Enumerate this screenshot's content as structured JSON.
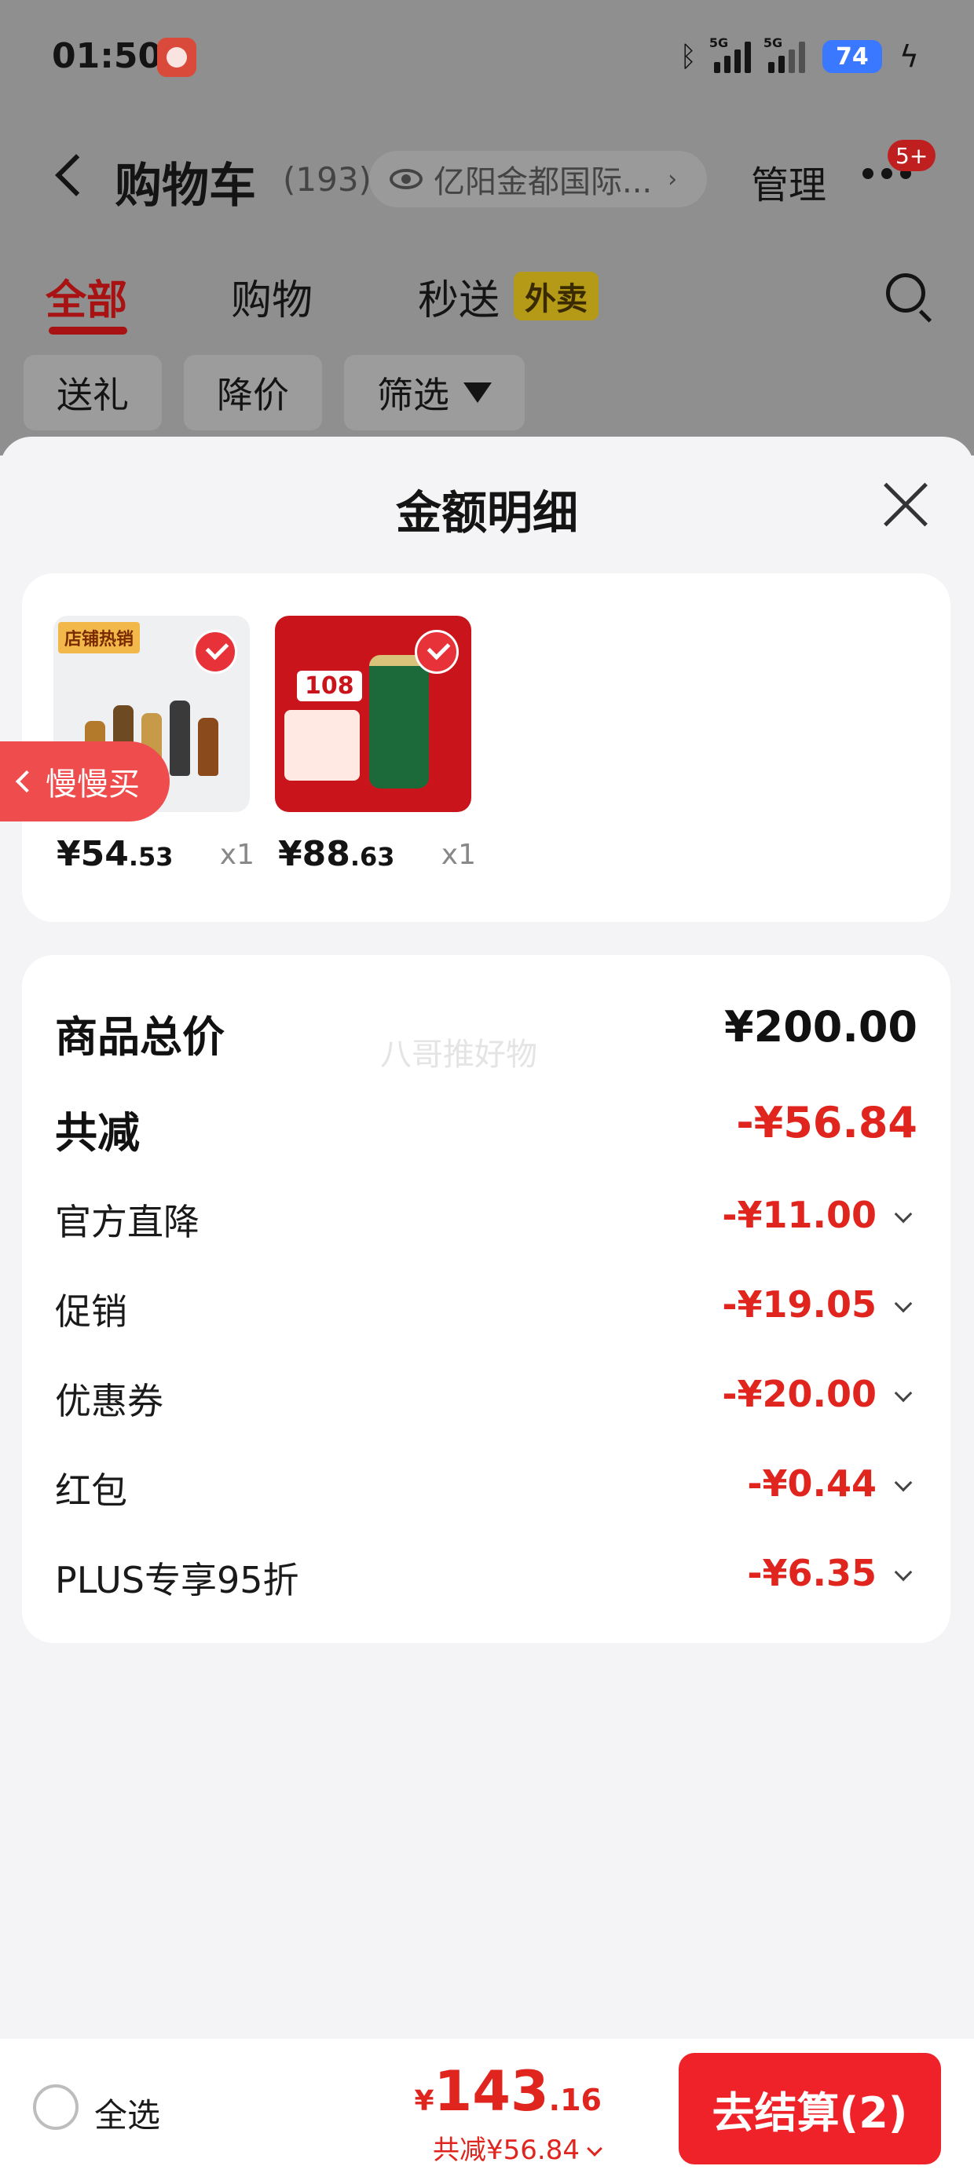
{
  "status_bar": {
    "time": "01:50",
    "network_1": "5G",
    "network_2": "5G",
    "battery": "74"
  },
  "nav": {
    "title": "购物车",
    "count": "(193)",
    "address": "亿阳金都国际...",
    "manage": "管理",
    "message_badge": "5+"
  },
  "tabs": [
    {
      "label": "全部"
    },
    {
      "label": "购物"
    },
    {
      "label": "秒送"
    }
  ],
  "tab_badge": "外卖",
  "filters": [
    {
      "label": "送礼"
    },
    {
      "label": "降价"
    },
    {
      "label": "筛选"
    }
  ],
  "sheet": {
    "title": "金额明细"
  },
  "goods": [
    {
      "price_yen": "¥54",
      "price_dec": ".53",
      "qty": "x1",
      "tag": "店铺热销"
    },
    {
      "price_yen": "¥88",
      "price_dec": ".63",
      "qty": "x1",
      "badge_num": "108"
    }
  ],
  "floating": {
    "slow_buy": "慢慢买"
  },
  "watermark": "八哥推好物",
  "details": {
    "total": {
      "label": "商品总价",
      "value": "¥200.00"
    },
    "reduced": {
      "label": "共减",
      "value": "-¥56.84"
    },
    "items": [
      {
        "label": "官方直降",
        "value": "-¥11.00"
      },
      {
        "label": "促销",
        "value": "-¥19.05"
      },
      {
        "label": "优惠券",
        "value": "-¥20.00"
      },
      {
        "label": "红包",
        "value": "-¥0.44"
      },
      {
        "label": "PLUS专享95折",
        "value": "-¥6.35"
      }
    ]
  },
  "bottom": {
    "select_all": "全选",
    "total_yen": "¥",
    "total_int": "143",
    "total_dec": ".16",
    "saved": "共减¥56.84",
    "checkout": "去结算(2)"
  },
  "colors": {
    "accent_red": "#e0251f",
    "button_red": "#ef2129",
    "tab_active": "#a81212"
  },
  "icons": [
    "back-icon",
    "eye-icon",
    "more-icon",
    "search-icon",
    "funnel-icon",
    "close-icon",
    "check-icon",
    "chevron-down-icon",
    "chevron-left-icon"
  ]
}
